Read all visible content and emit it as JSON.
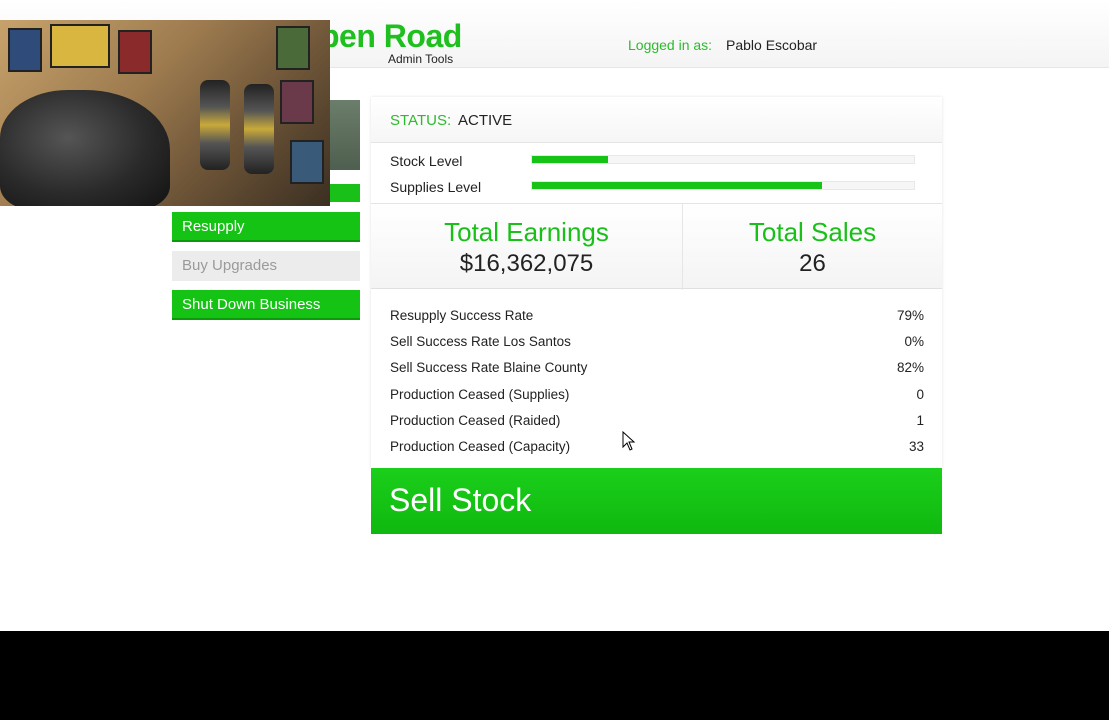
{
  "header": {
    "title": "pen Road",
    "subtitle": "Admin Tools",
    "login_label": "Logged in as:",
    "login_user": "Pablo Escobar"
  },
  "sidebar": {
    "buttons": [
      {
        "label": "Resupply",
        "state": "active"
      },
      {
        "label": "Buy Upgrades",
        "state": "disabled"
      },
      {
        "label": "Shut Down Business",
        "state": "active"
      }
    ]
  },
  "panel": {
    "status_label": "STATUS:",
    "status_value": "ACTIVE",
    "levels": [
      {
        "label": "Stock Level",
        "fill": 0.2
      },
      {
        "label": "Supplies Level",
        "fill": 0.76
      }
    ],
    "stats": [
      {
        "title": "Total Earnings",
        "value": "$16,362,075"
      },
      {
        "title": "Total Sales",
        "value": "26"
      }
    ],
    "metrics": [
      {
        "label": "Resupply Success Rate",
        "value": "79%"
      },
      {
        "label": "Sell Success Rate Los Santos",
        "value": "0%"
      },
      {
        "label": "Sell Success Rate Blaine County",
        "value": "82%"
      },
      {
        "label": "Production Ceased (Supplies)",
        "value": "0"
      },
      {
        "label": "Production Ceased (Raided)",
        "value": "1"
      },
      {
        "label": "Production Ceased (Capacity)",
        "value": "33"
      }
    ]
  },
  "sell_button": {
    "label": "Sell Stock"
  },
  "colors": {
    "accent": "#14c314",
    "disabled": "#ececec",
    "text": "#222222"
  }
}
